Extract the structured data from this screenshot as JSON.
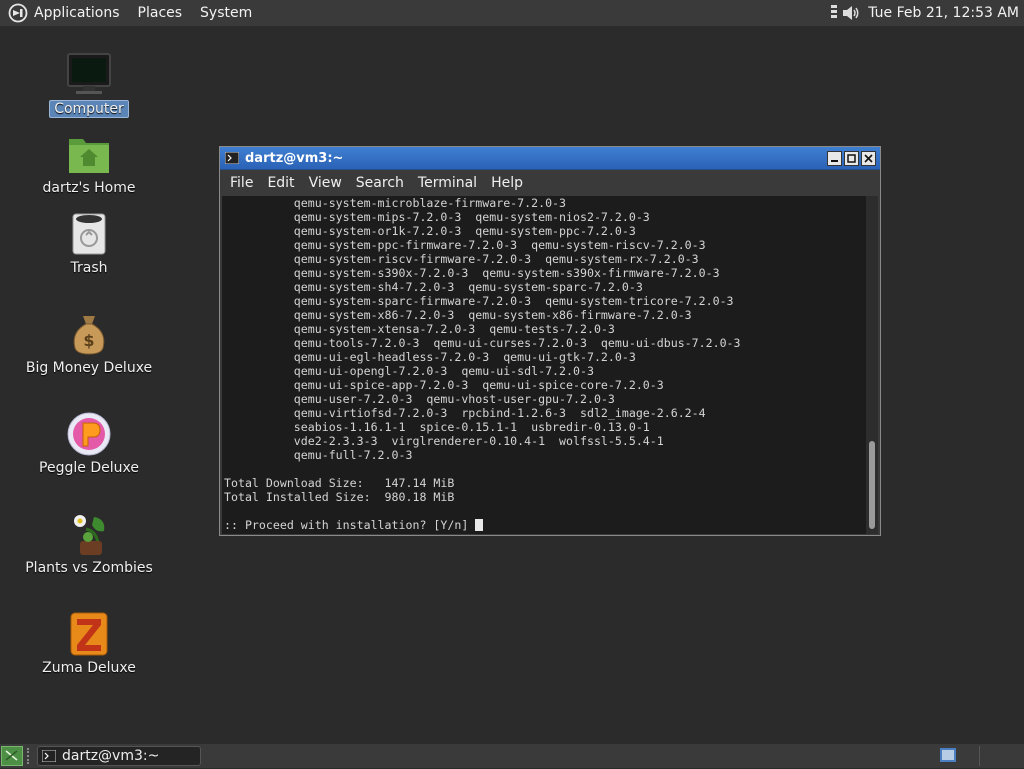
{
  "top_panel": {
    "menus": [
      "Applications",
      "Places",
      "System"
    ],
    "clock": "Tue Feb 21, 12:53 AM",
    "tray_icons": [
      "network-icon",
      "volume-icon"
    ]
  },
  "desktop": {
    "icons": [
      {
        "label": "Computer",
        "icon": "computer-icon",
        "selected": true
      },
      {
        "label": "dartz's Home",
        "icon": "home-folder-icon"
      },
      {
        "label": "Trash",
        "icon": "trash-icon"
      },
      {
        "label": "Big Money Deluxe",
        "icon": "money-bag-icon"
      },
      {
        "label": "Peggle Deluxe",
        "icon": "peggle-icon"
      },
      {
        "label": "Plants vs Zombies",
        "icon": "plant-icon"
      },
      {
        "label": "Zuma Deluxe",
        "icon": "zuma-icon"
      }
    ]
  },
  "window": {
    "title": "dartz@vm3:~",
    "menus": [
      "File",
      "Edit",
      "View",
      "Search",
      "Terminal",
      "Help"
    ],
    "lines": [
      "          qemu-system-microblaze-firmware-7.2.0-3",
      "          qemu-system-mips-7.2.0-3  qemu-system-nios2-7.2.0-3",
      "          qemu-system-or1k-7.2.0-3  qemu-system-ppc-7.2.0-3",
      "          qemu-system-ppc-firmware-7.2.0-3  qemu-system-riscv-7.2.0-3",
      "          qemu-system-riscv-firmware-7.2.0-3  qemu-system-rx-7.2.0-3",
      "          qemu-system-s390x-7.2.0-3  qemu-system-s390x-firmware-7.2.0-3",
      "          qemu-system-sh4-7.2.0-3  qemu-system-sparc-7.2.0-3",
      "          qemu-system-sparc-firmware-7.2.0-3  qemu-system-tricore-7.2.0-3",
      "          qemu-system-x86-7.2.0-3  qemu-system-x86-firmware-7.2.0-3",
      "          qemu-system-xtensa-7.2.0-3  qemu-tests-7.2.0-3",
      "          qemu-tools-7.2.0-3  qemu-ui-curses-7.2.0-3  qemu-ui-dbus-7.2.0-3",
      "          qemu-ui-egl-headless-7.2.0-3  qemu-ui-gtk-7.2.0-3",
      "          qemu-ui-opengl-7.2.0-3  qemu-ui-sdl-7.2.0-3",
      "          qemu-ui-spice-app-7.2.0-3  qemu-ui-spice-core-7.2.0-3",
      "          qemu-user-7.2.0-3  qemu-vhost-user-gpu-7.2.0-3",
      "          qemu-virtiofsd-7.2.0-3  rpcbind-1.2.6-3  sdl2_image-2.6.2-4",
      "          seabios-1.16.1-1  spice-0.15.1-1  usbredir-0.13.0-1",
      "          vde2-2.3.3-3  virglrenderer-0.10.4-1  wolfssl-5.5.4-1",
      "          qemu-full-7.2.0-3",
      "",
      "Total Download Size:   147.14 MiB",
      "Total Installed Size:  980.18 MiB",
      "",
      ":: Proceed with installation? [Y/n] "
    ]
  },
  "taskbar": {
    "task_label": "dartz@vm3:~"
  },
  "colors": {
    "titlebar": "#3673c8",
    "terminal_bg": "#1c1c1c",
    "panel": "#3a3a3a",
    "selection": "#5b85b7"
  }
}
